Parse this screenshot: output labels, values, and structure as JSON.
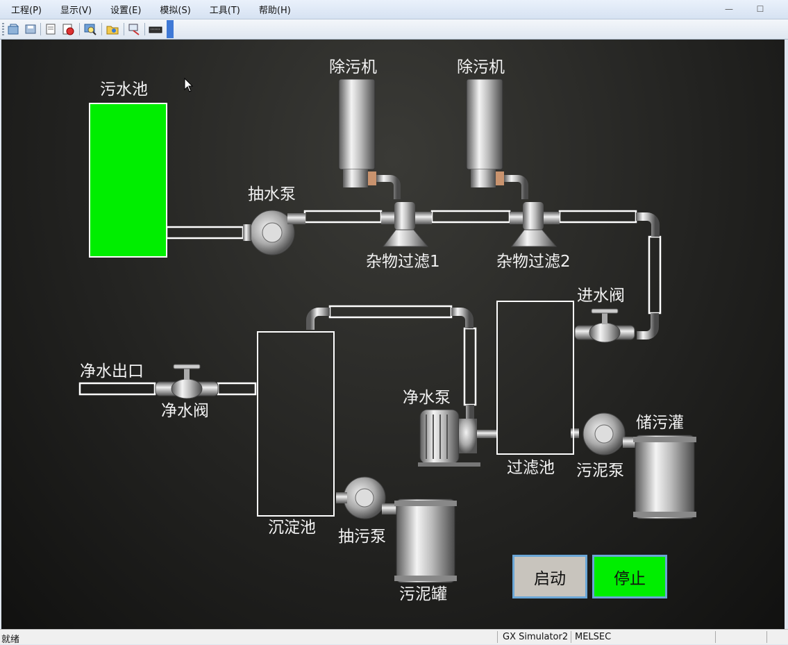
{
  "menu": {
    "items": [
      "工程(P)",
      "显示(V)",
      "设置(E)",
      "模拟(S)",
      "工具(T)",
      "帮助(H)"
    ]
  },
  "toolbar": {
    "icons": [
      "open-icon",
      "save-icon",
      "print-preview-icon",
      "record-icon",
      "monitor-search-icon",
      "device-folder-icon",
      "io-system-icon",
      "keyboard-icon"
    ]
  },
  "hmi": {
    "sewage_pool": "污水池",
    "pump_water": "抽水泵",
    "decontam_1": "除污机",
    "decontam_2": "除污机",
    "filter_1": "杂物过滤1",
    "filter_2": "杂物过滤2",
    "inlet_valve": "进水阀",
    "filter_tank": "过滤池",
    "clean_pump": "净水泵",
    "sludge_pump": "污泥泵",
    "sludge_storage": "储污灌",
    "settling_tank": "沉淀池",
    "sewage_pump": "抽污泵",
    "sludge_can": "污泥罐",
    "clean_outlet": "净水出口",
    "clean_valve": "净水阀",
    "start_button": "启动",
    "stop_button": "停止"
  },
  "colors": {
    "active_green": "#00ee00",
    "button_gray": "#c8c4bd",
    "canvas_dark": "#232321"
  },
  "status": {
    "ready": "就绪",
    "app": "GX Simulator2",
    "plc": "MELSEC"
  }
}
